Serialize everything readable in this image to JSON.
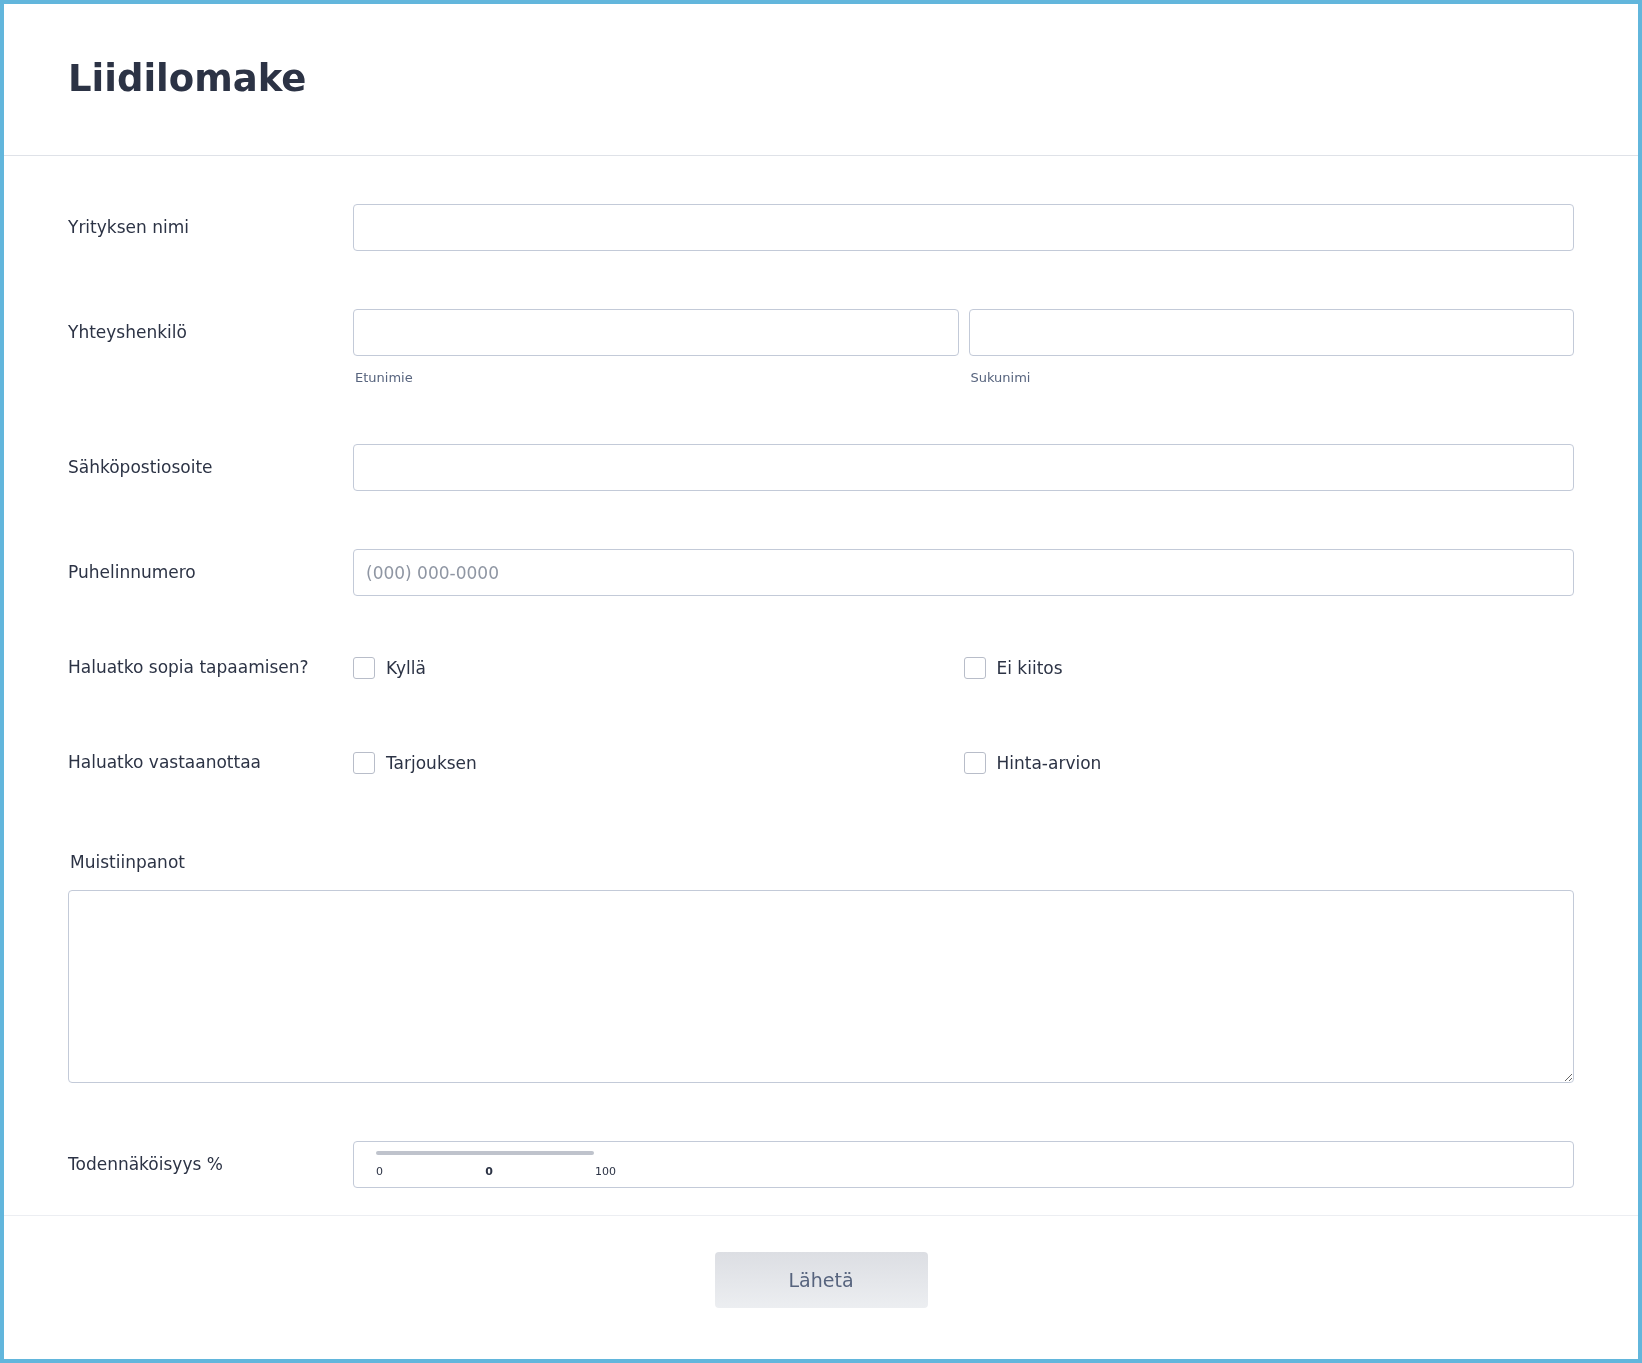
{
  "title": "Liidilomake",
  "fields": [
    {
      "kind": "text",
      "label": "Yrityksen nimi"
    },
    {
      "kind": "name",
      "label": "Yhteyshenkilö",
      "inputs": [
        {
          "sublabel": "Etunimie"
        },
        {
          "sublabel": "Sukunimi"
        }
      ]
    },
    {
      "kind": "text",
      "label": "Sähköpostiosoite"
    },
    {
      "kind": "text",
      "label": "Puhelinnumero",
      "placeholder": "(000) 000-0000"
    },
    {
      "kind": "checks",
      "label": "Haluatko sopia tapaamisen?",
      "options": [
        {
          "label": "Kyllä",
          "checked": false
        },
        {
          "label": "Ei kiitos",
          "checked": false
        }
      ]
    },
    {
      "kind": "checks",
      "label": "Haluatko vastaanottaa",
      "options": [
        {
          "label": "Tarjouksen",
          "checked": false
        },
        {
          "label": "Hinta-arvion",
          "checked": false
        }
      ]
    },
    {
      "kind": "textarea",
      "label": "Muistiinpanot"
    },
    {
      "kind": "slider",
      "label": "Todennäköisyys %",
      "level": 0,
      "min_label": "0",
      "value_label": "0",
      "max_label": "100"
    }
  ],
  "submit": {
    "label": "Lähetä"
  }
}
